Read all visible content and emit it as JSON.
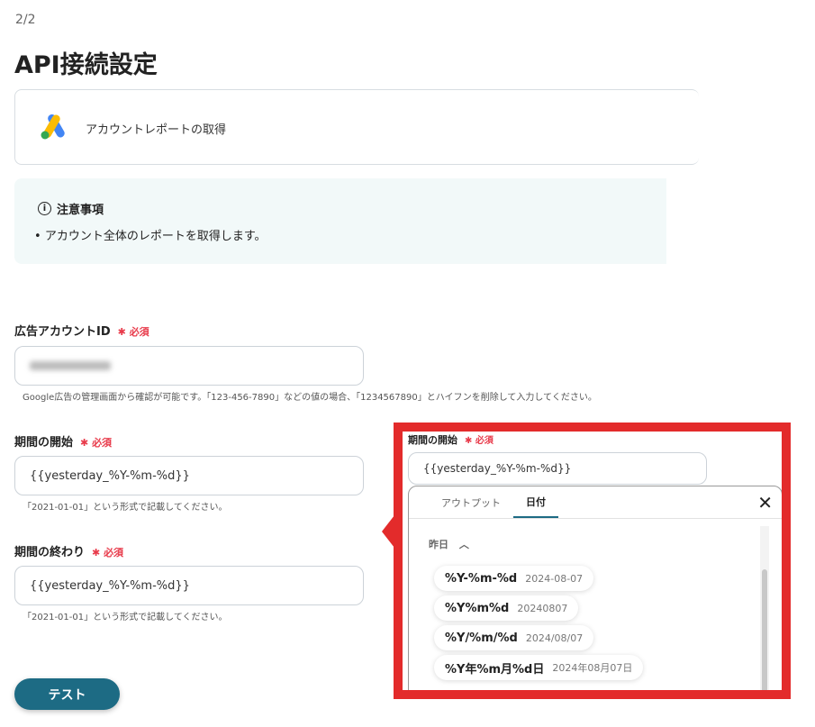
{
  "step": "2/2",
  "title": "API接続設定",
  "app": {
    "action": "アカウントレポートの取得",
    "icon": "google-ads-icon"
  },
  "notice": {
    "heading": "注意事項",
    "bullet": "アカウント全体のレポートを取得します。"
  },
  "required": "必須",
  "fields": [
    {
      "label": "広告アカウントID",
      "value": "",
      "hint": "Google広告の管理画面から確認が可能です。「123-456-7890」などの値の場合、「1234567890」とハイフンを削除して入力してください。"
    },
    {
      "label": "期間の開始",
      "value": "{{yesterday_%Y-%m-%d}}",
      "hint": "「2021-01-01」という形式で記載してください。"
    },
    {
      "label": "期間の終わり",
      "value": "{{yesterday_%Y-%m-%d}}",
      "hint": "「2021-01-01」という形式で記載してください。"
    }
  ],
  "test_button": "テスト",
  "callout": {
    "label": "期間の開始",
    "value": "{{yesterday_%Y-%m-%d}}",
    "tabs": [
      "アウトプット",
      "日付"
    ],
    "section": "昨日",
    "chips": [
      {
        "format": "%Y-%m-%d",
        "example": "2024-08-07"
      },
      {
        "format": "%Y%m%d",
        "example": "20240807"
      },
      {
        "format": "%Y/%m/%d",
        "example": "2024/08/07"
      },
      {
        "format": "%Y年%m月%d日",
        "example": "2024年08月07日"
      }
    ]
  },
  "colors": {
    "accent": "#1d6b84",
    "required": "#e83a4a",
    "highlight": "#e32b2b"
  }
}
